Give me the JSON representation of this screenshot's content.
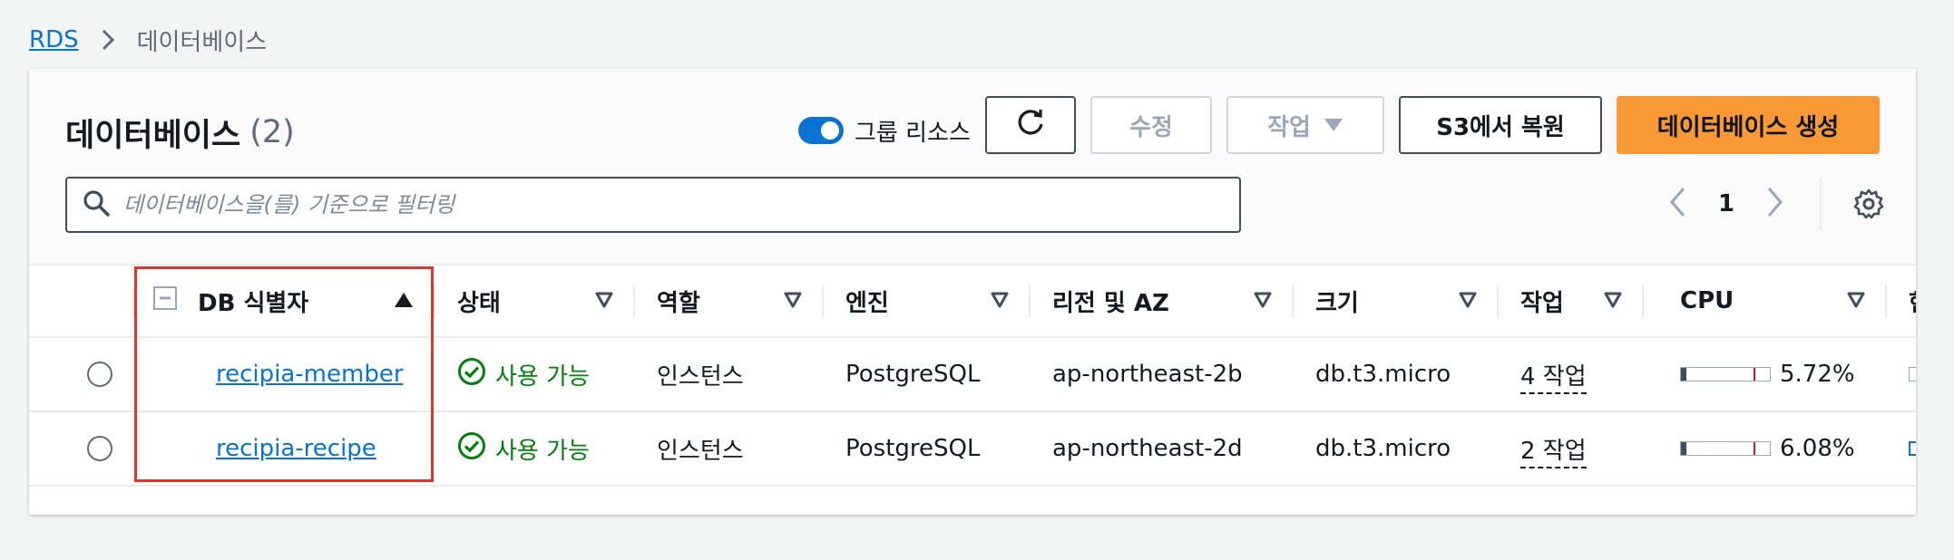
{
  "breadcrumb": {
    "root": "RDS",
    "current": "데이터베이스"
  },
  "panel": {
    "title": "데이터베이스",
    "count": "(2)",
    "group_toggle_label": "그룹 리소스",
    "buttons": {
      "refresh": "refresh-icon",
      "modify": "수정",
      "actions": "작업",
      "restore_s3": "S3에서 복원",
      "create": "데이터베이스 생성"
    },
    "search": {
      "placeholder": "데이터베이스을(를) 기준으로 필터링",
      "value": ""
    },
    "pagination": {
      "current_page": "1"
    }
  },
  "table": {
    "columns": {
      "identifier": "DB 식별자",
      "status": "상태",
      "role": "역할",
      "engine": "엔진",
      "region_az": "리전 및 AZ",
      "size": "크기",
      "actions": "작업",
      "cpu": "CPU",
      "next": "현"
    },
    "rows": [
      {
        "identifier": "recipia-member",
        "status": "사용 가능",
        "role": "인스턴스",
        "engine": "PostgreSQL",
        "region_az": "ap-northeast-2b",
        "size": "db.t3.micro",
        "actions": "4 작업",
        "cpu": "5.72%",
        "cpu_fraction": 0.0572
      },
      {
        "identifier": "recipia-recipe",
        "status": "사용 가능",
        "role": "인스턴스",
        "engine": "PostgreSQL",
        "region_az": "ap-northeast-2d",
        "size": "db.t3.micro",
        "actions": "2 작업",
        "cpu": "6.08%",
        "cpu_fraction": 0.0608
      }
    ]
  },
  "colors": {
    "link": "#0972d3",
    "primary_button": "#f89936",
    "status_ok": "#037f0c",
    "highlight_box": "#e0352b"
  }
}
